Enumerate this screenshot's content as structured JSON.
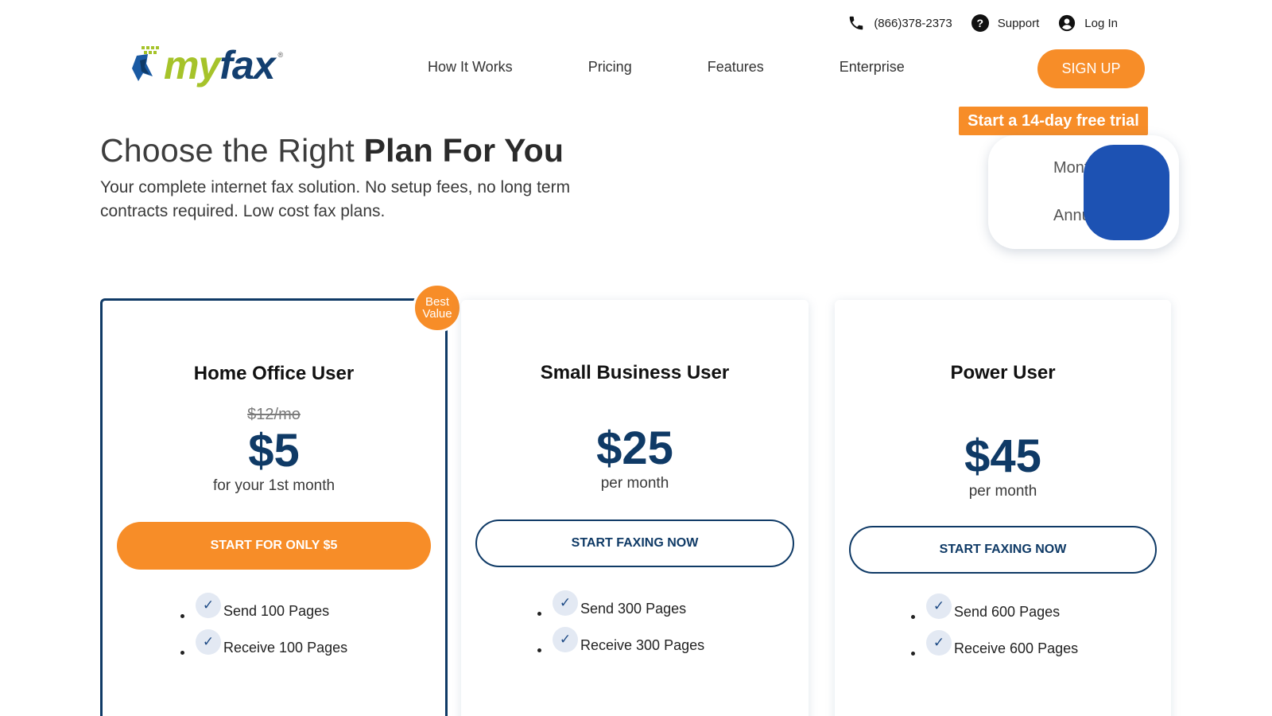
{
  "topbar": {
    "phone": "(866)378-2373",
    "support": "Support",
    "login": "Log In",
    "icons": {
      "phone": "phone-icon",
      "support": "help-circle-icon",
      "login": "user-circle-icon"
    }
  },
  "brand": {
    "my": "my",
    "fax": "fax",
    "reg": "®"
  },
  "nav": {
    "items": [
      {
        "label": "How It Works"
      },
      {
        "label": "Pricing"
      },
      {
        "label": "Features"
      },
      {
        "label": "Enterprise"
      }
    ],
    "signup": "SIGN UP"
  },
  "hero": {
    "title_light": "Choose the Right ",
    "title_bold": "Plan For You",
    "subtitle": "Your complete internet fax solution. No setup fees, no long term contracts required. Low cost fax plans."
  },
  "billing": {
    "trial_tag": "Start a 14-day free trial",
    "monthly": "Monthly",
    "annual": "Annual"
  },
  "badge": {
    "line1": "Best",
    "line2": "Value"
  },
  "plans": [
    {
      "name": "Home Office User",
      "old_price": "$12/mo",
      "price": "$5",
      "period": "for your 1st month",
      "cta": "START FOR ONLY $5",
      "features": [
        "Send 100 Pages",
        "Receive 100 Pages"
      ]
    },
    {
      "name": "Small Business User",
      "price": "$25",
      "period": "per month",
      "cta": "START FAXING NOW",
      "features": [
        "Send 300 Pages",
        "Receive 300 Pages"
      ]
    },
    {
      "name": "Power User",
      "price": "$45",
      "period": "per month",
      "cta": "START FAXING NOW",
      "features": [
        "Send 600 Pages",
        "Receive 600 Pages"
      ]
    }
  ],
  "colors": {
    "accent_orange": "#f78d28",
    "navy": "#0f3a66",
    "toggle_blue": "#1d52b3",
    "logo_green": "#a6c32a"
  }
}
